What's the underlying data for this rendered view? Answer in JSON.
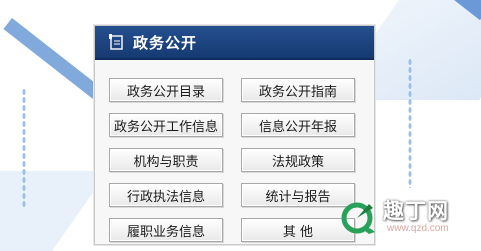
{
  "panel": {
    "title": "政务公开",
    "items": [
      {
        "label": "政务公开目录"
      },
      {
        "label": "政务公开指南"
      },
      {
        "label": "政务公开工作信息"
      },
      {
        "label": "信息公开年报"
      },
      {
        "label": "机构与职责"
      },
      {
        "label": "法规政策"
      },
      {
        "label": "行政执法信息"
      },
      {
        "label": "统计与报告"
      },
      {
        "label": "履职业务信息"
      },
      {
        "label": "其 他"
      }
    ]
  },
  "watermark": {
    "brand": "趣丁网",
    "url": "www.qzd.com",
    "colors": {
      "mark_green": "#2aa15a",
      "mark_dark": "#1d7d43"
    }
  },
  "colors": {
    "header_bg": "#1f4584",
    "accent_stripe": "#6c9ad6"
  }
}
